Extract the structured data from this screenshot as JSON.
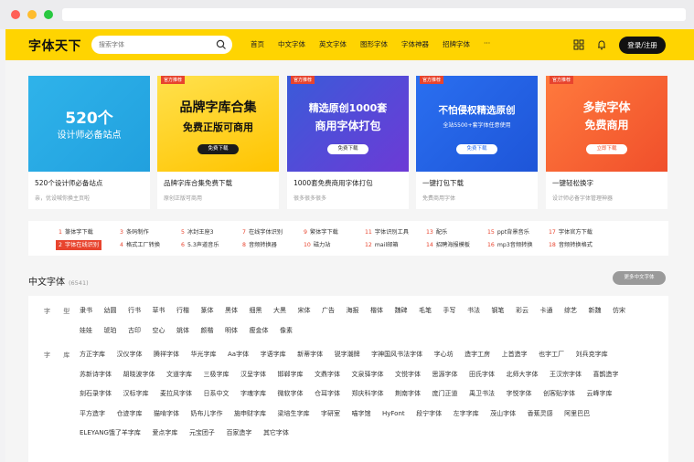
{
  "header": {
    "logo": "字体天下",
    "search_placeholder": "搜索字体",
    "nav": [
      "首页",
      "中文字体",
      "英文字体",
      "图形字体",
      "字体神器",
      "招牌字体",
      "···"
    ],
    "login": "登录/注册"
  },
  "cards": [
    {
      "banner_line1": "520个",
      "banner_line2": "设计师必备站点",
      "tag": "",
      "button": "",
      "title": "520个设计师必备站点",
      "subtitle": "亲，优设喊你换主页啦"
    },
    {
      "banner_line1": "品牌字库合集",
      "banner_line2": "免费正版可商用",
      "tag": "官方推荐",
      "button": "免费下载",
      "title": "品牌字库合集免费下载",
      "subtitle": "原创正版可商用"
    },
    {
      "banner_line1": "精选原创1000套",
      "banner_line2": "商用字体打包",
      "tag": "官方推荐",
      "button": "免费下载",
      "title": "1000套免费商用字体打包",
      "subtitle": "很多很多很多"
    },
    {
      "banner_line1": "不怕侵权精选原创",
      "banner_line2": "全站5500+套字体任意使用",
      "tag": "官方推荐",
      "button": "免费下载",
      "title": "一键打包下载",
      "subtitle": "免费商用字体"
    },
    {
      "banner_line1": "多款字体",
      "banner_line2": "免费商用",
      "tag": "官方推荐",
      "button": "立即下载",
      "title": "一键轻松换字",
      "subtitle": "设计师必备字体管理神器"
    }
  ],
  "hot": [
    {
      "n": "1",
      "t": "篆体字下载"
    },
    {
      "n": "3",
      "t": "条码制作"
    },
    {
      "n": "5",
      "t": "冰封王座3"
    },
    {
      "n": "7",
      "t": "在线字体识别"
    },
    {
      "n": "9",
      "t": "繁体字下载"
    },
    {
      "n": "11",
      "t": "字体识别工具"
    },
    {
      "n": "13",
      "t": "配乐"
    },
    {
      "n": "15",
      "t": "ppt背景音乐"
    },
    {
      "n": "17",
      "t": "字体官方下载"
    },
    {
      "n": "2",
      "t": "字体在线识别"
    },
    {
      "n": "4",
      "t": "格式工厂转换"
    },
    {
      "n": "6",
      "t": "5.3声道音乐"
    },
    {
      "n": "8",
      "t": "音频转换器"
    },
    {
      "n": "10",
      "t": "磁力站"
    },
    {
      "n": "12",
      "t": "mail邮箱"
    },
    {
      "n": "14",
      "t": "招聘海报模板"
    },
    {
      "n": "16",
      "t": "mp3音频转换"
    },
    {
      "n": "18",
      "t": "音频转换格式"
    }
  ],
  "section": {
    "title": "中文字体",
    "count": "(6541)",
    "more": "更多中文字体",
    "type_label": "字 型",
    "types": [
      "隶书",
      "幼圆",
      "行书",
      "草书",
      "行楷",
      "篆体",
      "黑体",
      "细黑",
      "大黑",
      "宋体",
      "广告",
      "海报",
      "楷体",
      "魏碑",
      "毛笔",
      "手写",
      "书法",
      "钢笔",
      "彩云",
      "卡通",
      "综艺",
      "新魏",
      "仿宋",
      "娃娃",
      "琥珀",
      "古印",
      "空心",
      "姚体",
      "颜楷",
      "明体",
      "瘦金体",
      "像素"
    ],
    "lib_label": "字 库",
    "libs": [
      "方正字库",
      "汉仪字体",
      "腾祥字体",
      "华光字库",
      "Aa字体",
      "字语字库",
      "新蒂字体",
      "锐字潮牌",
      "字神国风书法字体",
      "字心坊",
      "造字工房",
      "上首造字",
      "也字工厂",
      "刘兵克字库",
      "苏新诗字体",
      "胡晓波字体",
      "文道字库",
      "三极字库",
      "汉呈字体",
      "邯郸字库",
      "文鼎字体",
      "文泉驿字体",
      "文悦字体",
      "思源字体",
      "田氏字体",
      "北师大字体",
      "王汉宗字体",
      "喜鹊造字",
      "刻石录字体",
      "汉标字库",
      "麦拉风字体",
      "日系中文",
      "字魂字库",
      "微软字体",
      "仓耳字体",
      "郑庆科字体",
      "荆南字体",
      "庞门正道",
      "禹卫书法",
      "字悦字体",
      "创客贴字体",
      "云峰字库",
      "平方造字",
      "仓迹字库",
      "猫啃字体",
      "奶布儿字作",
      "施申财字库",
      "梁培生字库",
      "字研室",
      "喵字馆",
      "HyFont",
      "段宁字体",
      "左字字库",
      "茂山字体",
      "香蕉灵感",
      "阿里巴巴",
      "ELEYANG饿了羊字库",
      "爱点字库",
      "元宝团子",
      "百家造字",
      "其它字体"
    ]
  },
  "colors": {
    "brand": "#ffd401",
    "accent": "#e8442e"
  }
}
